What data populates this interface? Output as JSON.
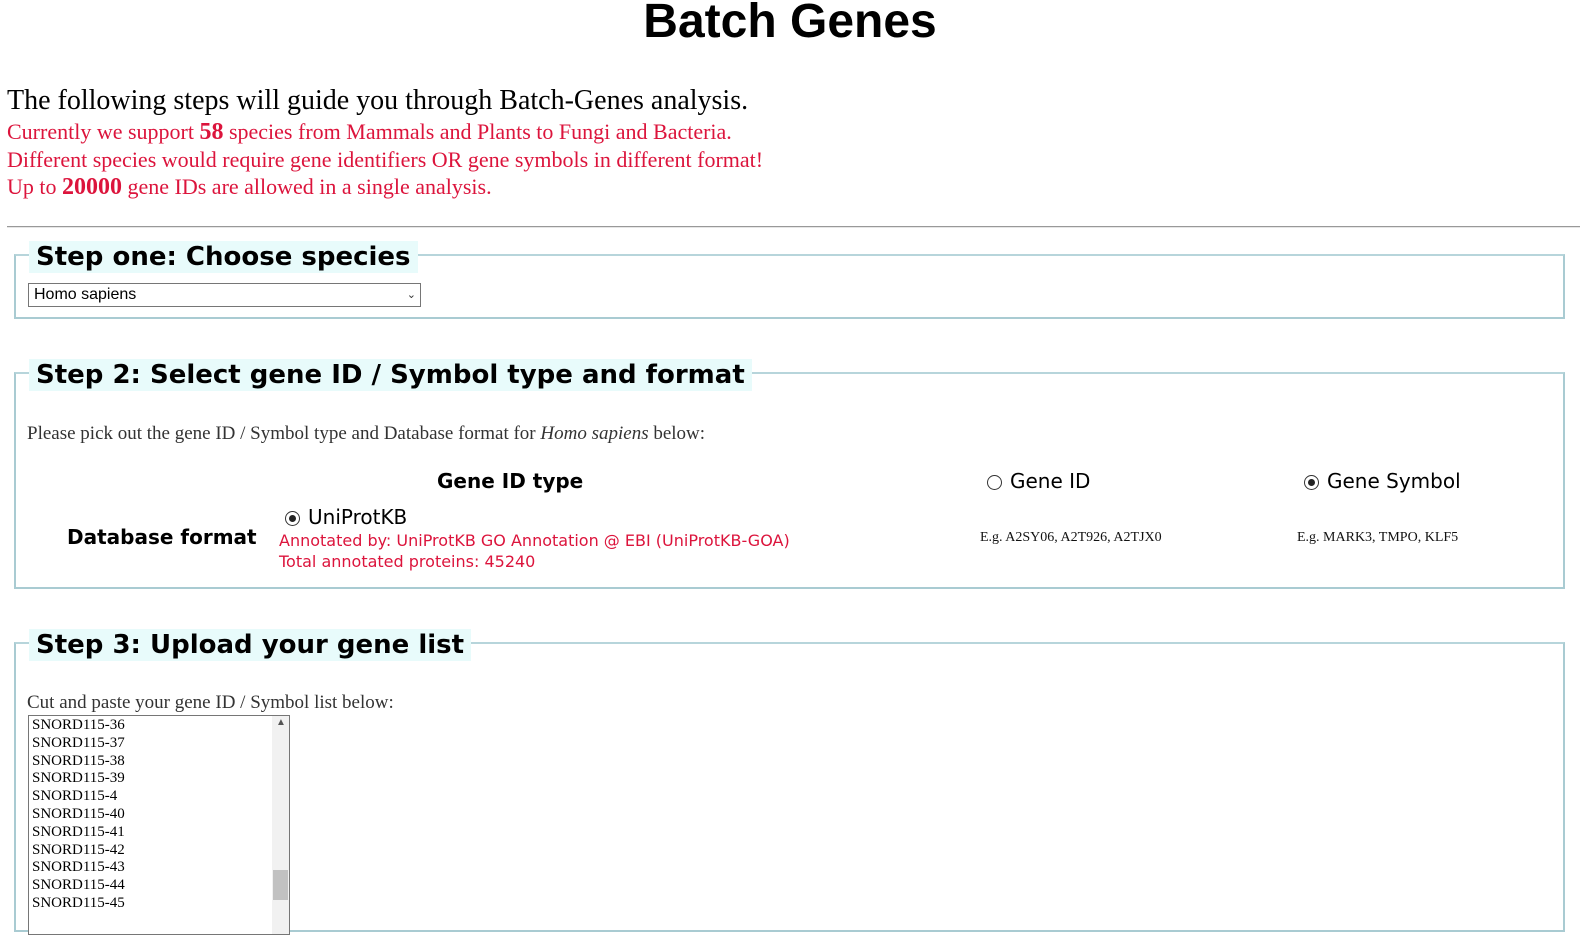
{
  "header": {
    "title": "Batch Genes"
  },
  "intro": {
    "line1": "The following steps will guide you through Batch-Genes analysis.",
    "line2_pre": "Currently we support ",
    "line2_num": "58",
    "line2_post": " species from Mammals and Plants to Fungi and Bacteria.",
    "line3": "Different species would require gene identifiers OR gene symbols in different format!",
    "line4_pre": "Up to ",
    "line4_num": "20000",
    "line4_post": " gene IDs are allowed in a single analysis."
  },
  "step1": {
    "legend": "Step one: Choose species",
    "species_select_value": "Homo sapiens"
  },
  "step2": {
    "legend": "Step 2: Select gene ID / Symbol type and format",
    "pick_pre": "Please pick out the gene ID / Symbol type and Database format for ",
    "pick_species": "Homo sapiens",
    "pick_post": " below:",
    "gene_id_type_header": "Gene ID type",
    "database_format_header": "Database format",
    "option_gene_id": "Gene ID",
    "option_gene_symbol": "Gene Symbol",
    "selected_type": "Gene Symbol",
    "db_option": "UniProtKB",
    "annotated_by": "Annotated by: UniProtKB GO Annotation @ EBI (UniProtKB-GOA)",
    "total_proteins": "Total annotated proteins: 45240",
    "eg_gene_id": "E.g.  A2SY06,  A2T926,  A2TJX0",
    "eg_gene_symbol": "E.g.  MARK3,  TMPO,  KLF5"
  },
  "step3": {
    "legend": "Step 3: Upload your gene list",
    "cut_text": "Cut and paste your gene ID / Symbol list below:",
    "gene_list": [
      "SNORD115-36",
      "SNORD115-37",
      "SNORD115-38",
      "SNORD115-39",
      "SNORD115-4",
      "SNORD115-40",
      "SNORD115-41",
      "SNORD115-42",
      "SNORD115-43",
      "SNORD115-44",
      "SNORD115-45"
    ]
  }
}
